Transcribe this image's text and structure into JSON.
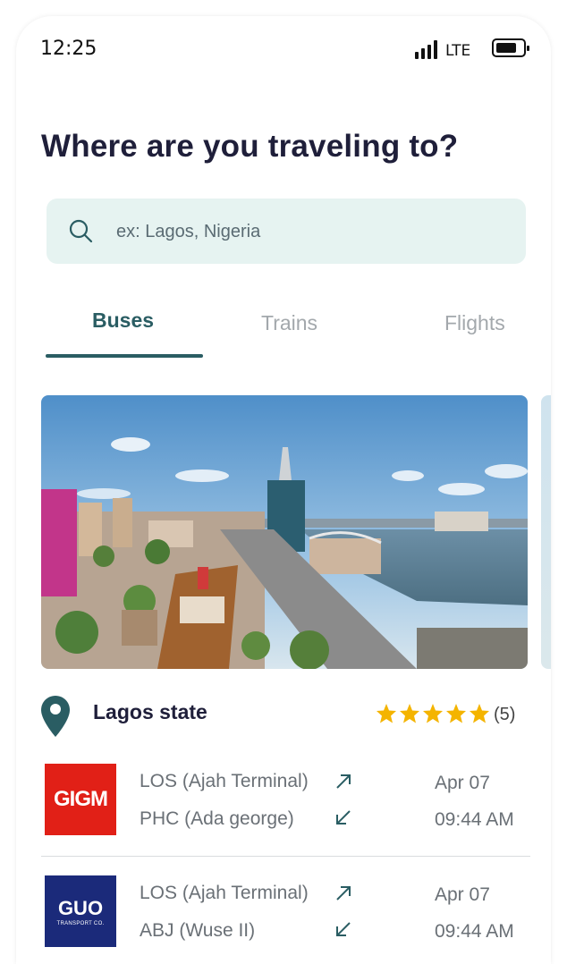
{
  "status_bar": {
    "time": "12:25",
    "network": "LTE"
  },
  "header": {
    "title": "Where are you traveling to?"
  },
  "search": {
    "placeholder": "ex: Lagos, Nigeria"
  },
  "tabs": [
    {
      "label": "Buses",
      "active": true
    },
    {
      "label": "Trains",
      "active": false
    },
    {
      "label": "Flights",
      "active": false
    }
  ],
  "destination": {
    "name": "Lagos state",
    "rating": 5,
    "rating_count": "(5)"
  },
  "routes": [
    {
      "operator_logo": "GIGM",
      "operator_color": "#e12017",
      "from": "LOS (Ajah Terminal)",
      "to": "PHC (Ada george)",
      "date": "Apr 07",
      "time": "09:44 AM"
    },
    {
      "operator_logo": "GUO",
      "operator_subtitle": "TRANSPORT CO.",
      "operator_color": "#1b2a7a",
      "from": "LOS (Ajah Terminal)",
      "to": "ABJ (Wuse II)",
      "date": "Apr 07",
      "time": "09:44 AM"
    }
  ],
  "colors": {
    "accent": "#2a5d63",
    "search_bg": "#e6f3f1",
    "star": "#f4b400",
    "title": "#1f1f3a"
  },
  "icons": {
    "search": "search-icon",
    "pin": "location-pin-icon",
    "star": "star-icon",
    "departure": "arrow-up-right-icon",
    "arrival": "arrow-down-left-icon"
  }
}
